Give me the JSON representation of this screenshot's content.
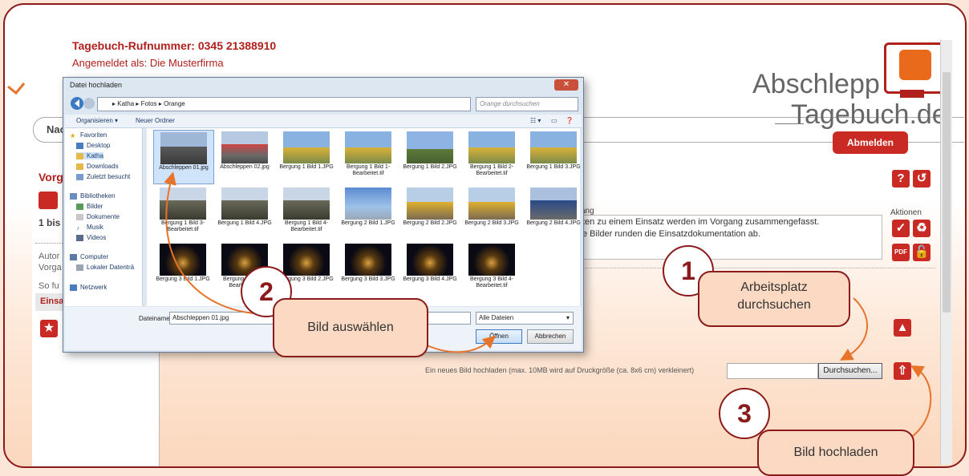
{
  "header": {
    "diary_phone": "Tagebuch-Rufnummer: 0345 21388910",
    "logged_in": "Angemeldet als: Die Musterfirma"
  },
  "nav": {
    "partial_label": "Nac"
  },
  "logo": {
    "line1": "Abschlepp",
    "line2": "Tagebuch.de"
  },
  "logout_label": "Abmelden",
  "sidebar": {
    "title": "Vorg",
    "count": "1 bis 3",
    "text1a": "Autor",
    "text1b": "Vorga",
    "text2": "So fu",
    "tab": "Einsa"
  },
  "main": {
    "desc_label": "ang",
    "desc_line1": "ten zu einem Einsatz werden im Vorgang zusammengefasst.",
    "desc_line2": "e Bilder runden die Einsatzdokumentation ab.",
    "aktionen": "Aktionen",
    "upload_text": "Ein neues Bild hochladen (max. 10MB wird auf Druckgröße (ca. 8x6 cm) verkleinert)",
    "browse_button": "Durchsuchen..."
  },
  "dialog": {
    "title": "Datei hochladen",
    "path": "▸ Katha ▸ Fotos ▸ Orange",
    "search_placeholder": "Orange durchsuchen",
    "organize": "Organisieren ▾",
    "new_folder": "Neuer Ordner",
    "nav": {
      "favorites": "Favoriten",
      "desktop": "Desktop",
      "katha": "Katha",
      "downloads": "Downloads",
      "recent": "Zuletzt besucht",
      "libraries": "Bibliotheken",
      "pictures": "Bilder",
      "documents": "Dokumente",
      "music": "Musik",
      "videos": "Videos",
      "computer": "Computer",
      "local_disk": "Lokaler Datenträ",
      "network": "Netzwerk"
    },
    "files": [
      {
        "name": "Abschleppen 01.jpg",
        "kind": "car"
      },
      {
        "name": "Abschleppen 02.jpg",
        "kind": "truck"
      },
      {
        "name": "Bergung 1 Bild 1.JPG",
        "kind": "crane"
      },
      {
        "name": "Bergung 1 Bild 1-Bearbeitet.tif",
        "kind": "crane"
      },
      {
        "name": "Bergung 1 Bild 2.JPG",
        "kind": "field"
      },
      {
        "name": "Bergung 1 Bild 2-Bearbeitet.tif",
        "kind": "crane"
      },
      {
        "name": "Bergung 1 Bild 3.JPG",
        "kind": "crane"
      },
      {
        "name": "Bergung 1 Bild 3-Bearbeitet.tif",
        "kind": "wreck"
      },
      {
        "name": "Bergung 1 Bild 4.JPG",
        "kind": "wreck"
      },
      {
        "name": "Bergung 1 Bild 4-Bearbeitet.tif",
        "kind": "wreck"
      },
      {
        "name": "Bergung 2 Bild 1.JPG",
        "kind": "sky"
      },
      {
        "name": "Bergung 2 Bild 2.JPG",
        "kind": "loader"
      },
      {
        "name": "Bergung 2 Bild 3.JPG",
        "kind": "loader"
      },
      {
        "name": "Bergung 2 Bild 4.JPG",
        "kind": "lorry"
      },
      {
        "name": "Bergung 3 Bild 1.JPG",
        "kind": "night"
      },
      {
        "name": "Bergung 3 Bild 1-Bearbeitet.tif",
        "kind": "night"
      },
      {
        "name": "Bergung 3 Bild 2.JPG",
        "kind": "night"
      },
      {
        "name": "Bergung 3 Bild 3.JPG",
        "kind": "night"
      },
      {
        "name": "Bergung 3 Bild 4.JPG",
        "kind": "night"
      },
      {
        "name": "Bergung 3 Bild 4-Bearbeitet.tif",
        "kind": "night"
      }
    ],
    "filename_label": "Dateiname:",
    "filename_value": "Abschleppen 01.jpg",
    "filetype": "Alle Dateien",
    "open_button": "Öffnen",
    "cancel_button": "Abbrechen"
  },
  "callouts": {
    "step1_num": "1",
    "step1_text_a": "Arbeitsplatz",
    "step1_text_b": "durchsuchen",
    "step2_num": "2",
    "step2_text": "Bild auswählen",
    "step3_num": "3",
    "step3_text": "Bild hochladen"
  },
  "colors": {
    "brand_red": "#c92a24",
    "frame_red": "#8b1a1a",
    "callout_fill": "#fbd9c2",
    "arrow_orange": "#e8732a"
  }
}
